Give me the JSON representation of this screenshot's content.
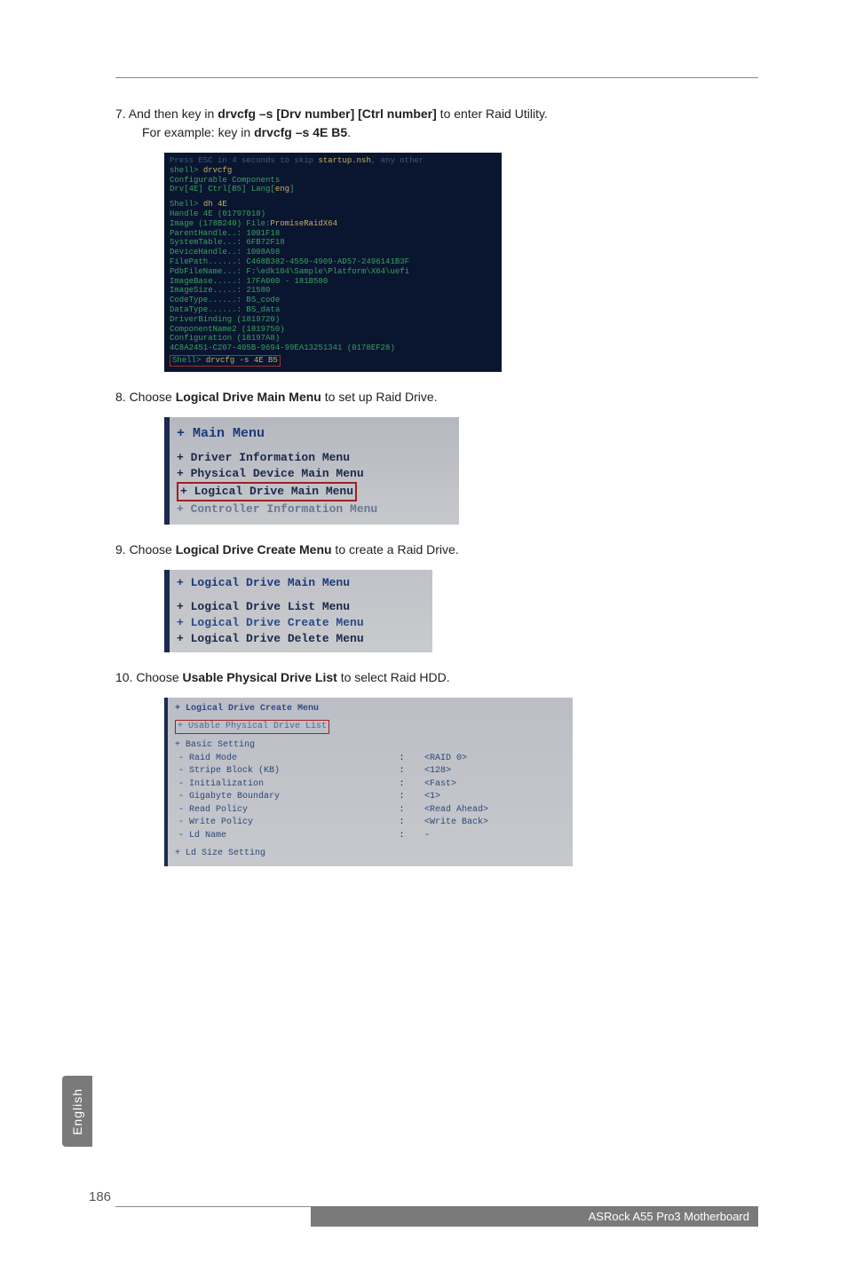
{
  "steps": {
    "s7a": "7. And then key in ",
    "s7b": "drvcfg –s [Drv number] [Ctrl number]",
    "s7c": " to enter Raid Utility.",
    "s7d": "For example: key in ",
    "s7e": "drvcfg –s 4E B5",
    "s7f": ".",
    "s8a": "8. Choose ",
    "s8b": "Logical Drive Main Menu",
    "s8c": " to set up Raid Drive.",
    "s9a": "9. Choose ",
    "s9b": "Logical Drive Create Menu",
    "s9c": " to create a Raid Drive.",
    "s10a": "10. Choose ",
    "s10b": "Usable Physical Drive List",
    "s10c": " to select Raid HDD."
  },
  "term": {
    "l0a": "Press ESC in 4 seconds to skip ",
    "l0b": "startup.nsh",
    "l0c": ", any other",
    "l1a": "shell> ",
    "l1b": "drvcfg",
    "l2": "Configurable Components",
    "l3a": "  Drv[4E]  Ctrl[B5]  Lang[",
    "l3b": "eng",
    "l3c": "]",
    "l4a": "Shell> ",
    "l4b": "dh 4E",
    "l5": "Handle 4E (01797018)",
    "l6a": "    Image (178B240)   File:",
    "l6b": "PromiseRaidX64",
    "l7": "       ParentHandle..: 1001F18",
    "l8": "       SystemTable...: 6FB72F18",
    "l9": "       DeviceHandle..: 1008A98",
    "l10": "       FilePath......: C468B382-4550-4909-AD57-2496141B3F",
    "l11": "       PdbFileName...: F:\\edk104\\Sample\\Platform\\X64\\uefi",
    "l12": "       ImageBase.....: 17FA000 - 181B580",
    "l13": "       ImageSize.....: 21580",
    "l14": "       CodeType......: BS_code",
    "l15": "       DataType......: BS_data",
    "l16": "    DriverBinding (1819720)",
    "l17": "    ComponentName2 (1819750)",
    "l18": "    Configuration (18197A8)",
    "l19": "    4C8A2451-C207-405B-9694-99EA13251341 (0178EF28)",
    "l20a": "Shell> ",
    "l20b": "drvcfg -s 4E B5"
  },
  "menu2": {
    "t": "+ Main Menu",
    "i1": "+ Driver Information Menu",
    "i2": "+ Physical Device Main Menu",
    "i3": "+ Logical Drive Main Menu",
    "i4": "+ Controller Information Menu"
  },
  "menu3": {
    "t": "+ Logical Drive Main Menu",
    "i1": "+ Logical Drive List Menu",
    "i2": "+ Logical Drive Create Menu",
    "i3": "+ Logical Drive Delete Menu"
  },
  "menu4": {
    "t": "+ Logical Drive Create Menu",
    "sel": "+ Usable Physical Drive List",
    "h": "+ Basic Setting",
    "rows": [
      {
        "l": "- Raid Mode",
        "v": "<RAID 0>"
      },
      {
        "l": "- Stripe Block (KB)",
        "v": "<128>"
      },
      {
        "l": "- Initialization",
        "v": "<Fast>"
      },
      {
        "l": "- Gigabyte Boundary",
        "v": "<1>"
      },
      {
        "l": "- Read Policy",
        "v": "<Read Ahead>"
      },
      {
        "l": "- Write Policy",
        "v": "<Write Back>"
      },
      {
        "l": "- Ld Name",
        "v": "-"
      }
    ],
    "f": "+ Ld Size Setting"
  },
  "side": "English",
  "pagenum": "186",
  "footer": "ASRock  A55 Pro3  Motherboard"
}
